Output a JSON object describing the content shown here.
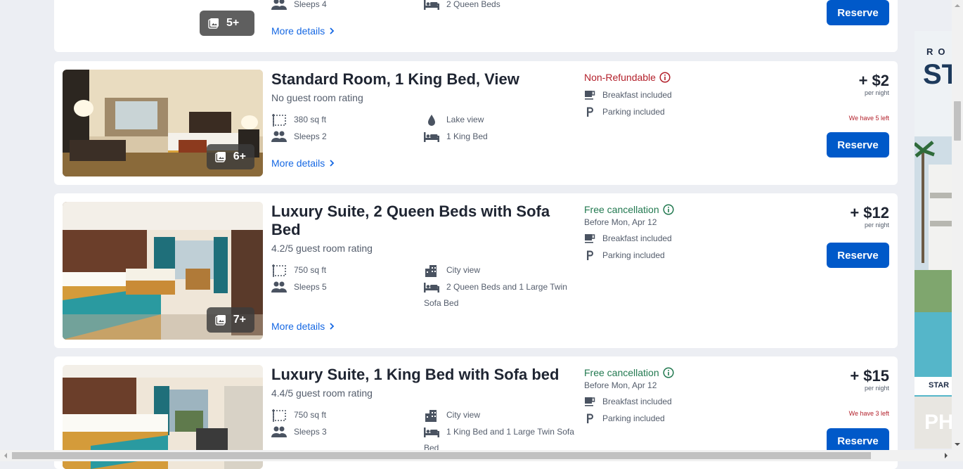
{
  "rooms": [
    {
      "photo_count": "5+",
      "sleeps": "Sleeps 4",
      "beds": "2 Queen Beds",
      "more_details": "More details",
      "reserve": "Reserve"
    },
    {
      "title": "Standard Room, 1 King Bed, View",
      "rating": "No guest room rating",
      "photo_count": "6+",
      "size": "380 sq ft",
      "view": "Lake view",
      "sleeps": "Sleeps 2",
      "beds": "1 King Bed",
      "more_details": "More details",
      "policy": "Non-Refundable",
      "breakfast": "Breakfast included",
      "parking": "Parking included",
      "price": "+ $2",
      "per_night": "per night",
      "availability": "We have 5 left",
      "reserve": "Reserve"
    },
    {
      "title": "Luxury Suite, 2 Queen Beds with Sofa Bed",
      "rating": "4.2/5 guest room rating",
      "photo_count": "7+",
      "size": "750 sq ft",
      "view": "City view",
      "sleeps": "Sleeps 5",
      "beds_line1": "2 Queen Beds and 1 Large Twin",
      "beds_line2": "Sofa Bed",
      "more_details": "More details",
      "policy": "Free cancellation",
      "policy_date": "Before Mon, Apr 12",
      "breakfast": "Breakfast included",
      "parking": "Parking included",
      "price": "+ $12",
      "per_night": "per night",
      "reserve": "Reserve"
    },
    {
      "title": "Luxury Suite, 1 King Bed with Sofa bed",
      "rating": "4.4/5 guest room rating",
      "size": "750 sq ft",
      "view": "City view",
      "sleeps": "Sleeps 3",
      "beds_line1": "1 King Bed and 1 Large Twin Sofa",
      "beds_line2": "Bed",
      "policy": "Free cancellation",
      "policy_date": "Before Mon, Apr 12",
      "breakfast": "Breakfast included",
      "parking": "Parking included",
      "price": "+ $15",
      "per_night": "per night",
      "availability": "We have 3 left",
      "reserve": "Reserve"
    }
  ],
  "ad": {
    "text_top": "RO",
    "text_big": "ST",
    "text_start": "STAR",
    "text_ph": "PH"
  },
  "colors": {
    "brand_blue": "#0059c9",
    "link_blue": "#1668e3",
    "refund_red": "#b3202b",
    "cancel_green": "#227950"
  }
}
